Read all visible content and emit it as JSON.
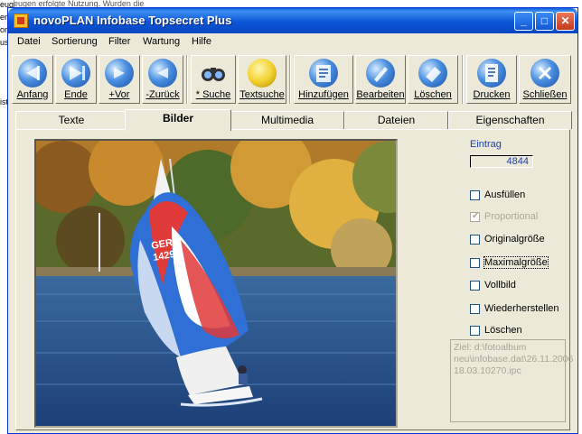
{
  "background_window": {
    "fragments": [
      "eugen erfolgte Nutzung. Wurden die",
      "ent",
      "orc",
      "us",
      "ist"
    ]
  },
  "window": {
    "title": "novoPLAN Infobase Topsecret Plus",
    "controls": {
      "minimize": "_",
      "maximize": "□",
      "close": "✕"
    }
  },
  "menu": [
    "Datei",
    "Sortierung",
    "Filter",
    "Wartung",
    "Hilfe"
  ],
  "toolbar": [
    {
      "label": "Anfang",
      "icon": "first-icon"
    },
    {
      "label": "Ende",
      "icon": "last-icon"
    },
    {
      "label": "+Vor",
      "icon": "forward-icon"
    },
    {
      "label": "-Zurück",
      "icon": "back-icon"
    },
    {
      "label": "* Suche",
      "icon": "binoculars-icon"
    },
    {
      "label": "Textsuche",
      "icon": "lightbulb-icon"
    },
    {
      "label": "Hinzufügen",
      "icon": "add-icon"
    },
    {
      "label": "Bearbeiten",
      "icon": "edit-icon"
    },
    {
      "label": "Löschen",
      "icon": "eraser-icon"
    },
    {
      "label": "Drucken",
      "icon": "print-icon"
    },
    {
      "label": "Schließen",
      "icon": "exit-icon"
    }
  ],
  "tabs": [
    "Texte",
    "Bilder",
    "Multimedia",
    "Dateien",
    "Eigenschaften"
  ],
  "active_tab": "Bilder",
  "side": {
    "eintrag_label": "Eintrag",
    "eintrag_value": "4844",
    "options": [
      {
        "label": "Ausfüllen",
        "checked": false,
        "disabled": false
      },
      {
        "label": "Proportional",
        "checked": true,
        "disabled": true
      },
      {
        "label": "Originalgröße",
        "checked": false,
        "disabled": false
      },
      {
        "label": "Maximalgröße",
        "checked": false,
        "disabled": false,
        "focused": true
      },
      {
        "label": "Vollbild",
        "checked": false,
        "disabled": false
      },
      {
        "label": "Wiederherstellen",
        "checked": false,
        "disabled": false
      },
      {
        "label": "Löschen",
        "checked": false,
        "disabled": false
      }
    ],
    "path_text": "Ziel: d:\\fotoalbum neu\\infobase.dat\\26.11.2006 18.03.10270.ipc"
  },
  "photo": {
    "sail_number": "GER\n1429",
    "sail_text_line1": "GER",
    "sail_text_line2": "1429"
  }
}
